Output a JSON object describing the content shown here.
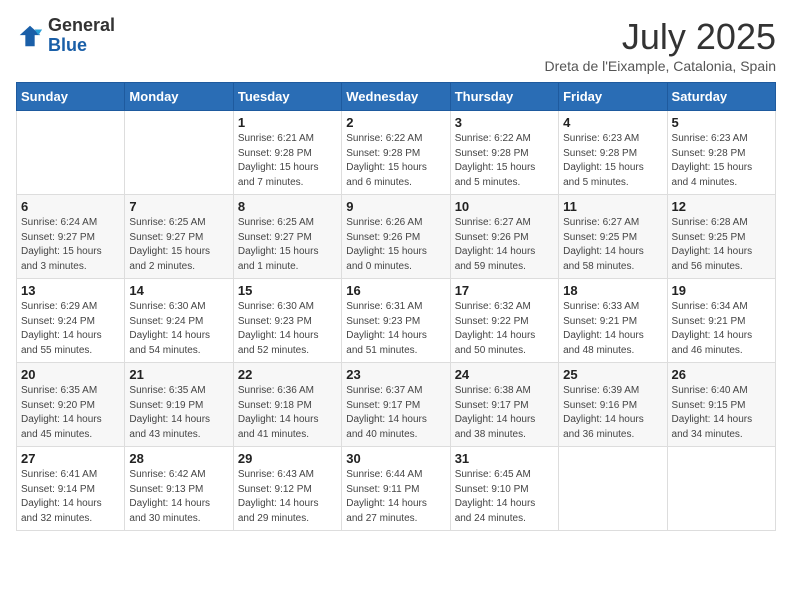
{
  "logo": {
    "general": "General",
    "blue": "Blue"
  },
  "title": {
    "month_year": "July 2025",
    "location": "Dreta de l'Eixample, Catalonia, Spain"
  },
  "days_of_week": [
    "Sunday",
    "Monday",
    "Tuesday",
    "Wednesday",
    "Thursday",
    "Friday",
    "Saturday"
  ],
  "weeks": [
    [
      {
        "day": "",
        "info": ""
      },
      {
        "day": "",
        "info": ""
      },
      {
        "day": "1",
        "info": "Sunrise: 6:21 AM\nSunset: 9:28 PM\nDaylight: 15 hours and 7 minutes."
      },
      {
        "day": "2",
        "info": "Sunrise: 6:22 AM\nSunset: 9:28 PM\nDaylight: 15 hours and 6 minutes."
      },
      {
        "day": "3",
        "info": "Sunrise: 6:22 AM\nSunset: 9:28 PM\nDaylight: 15 hours and 5 minutes."
      },
      {
        "day": "4",
        "info": "Sunrise: 6:23 AM\nSunset: 9:28 PM\nDaylight: 15 hours and 5 minutes."
      },
      {
        "day": "5",
        "info": "Sunrise: 6:23 AM\nSunset: 9:28 PM\nDaylight: 15 hours and 4 minutes."
      }
    ],
    [
      {
        "day": "6",
        "info": "Sunrise: 6:24 AM\nSunset: 9:27 PM\nDaylight: 15 hours and 3 minutes."
      },
      {
        "day": "7",
        "info": "Sunrise: 6:25 AM\nSunset: 9:27 PM\nDaylight: 15 hours and 2 minutes."
      },
      {
        "day": "8",
        "info": "Sunrise: 6:25 AM\nSunset: 9:27 PM\nDaylight: 15 hours and 1 minute."
      },
      {
        "day": "9",
        "info": "Sunrise: 6:26 AM\nSunset: 9:26 PM\nDaylight: 15 hours and 0 minutes."
      },
      {
        "day": "10",
        "info": "Sunrise: 6:27 AM\nSunset: 9:26 PM\nDaylight: 14 hours and 59 minutes."
      },
      {
        "day": "11",
        "info": "Sunrise: 6:27 AM\nSunset: 9:25 PM\nDaylight: 14 hours and 58 minutes."
      },
      {
        "day": "12",
        "info": "Sunrise: 6:28 AM\nSunset: 9:25 PM\nDaylight: 14 hours and 56 minutes."
      }
    ],
    [
      {
        "day": "13",
        "info": "Sunrise: 6:29 AM\nSunset: 9:24 PM\nDaylight: 14 hours and 55 minutes."
      },
      {
        "day": "14",
        "info": "Sunrise: 6:30 AM\nSunset: 9:24 PM\nDaylight: 14 hours and 54 minutes."
      },
      {
        "day": "15",
        "info": "Sunrise: 6:30 AM\nSunset: 9:23 PM\nDaylight: 14 hours and 52 minutes."
      },
      {
        "day": "16",
        "info": "Sunrise: 6:31 AM\nSunset: 9:23 PM\nDaylight: 14 hours and 51 minutes."
      },
      {
        "day": "17",
        "info": "Sunrise: 6:32 AM\nSunset: 9:22 PM\nDaylight: 14 hours and 50 minutes."
      },
      {
        "day": "18",
        "info": "Sunrise: 6:33 AM\nSunset: 9:21 PM\nDaylight: 14 hours and 48 minutes."
      },
      {
        "day": "19",
        "info": "Sunrise: 6:34 AM\nSunset: 9:21 PM\nDaylight: 14 hours and 46 minutes."
      }
    ],
    [
      {
        "day": "20",
        "info": "Sunrise: 6:35 AM\nSunset: 9:20 PM\nDaylight: 14 hours and 45 minutes."
      },
      {
        "day": "21",
        "info": "Sunrise: 6:35 AM\nSunset: 9:19 PM\nDaylight: 14 hours and 43 minutes."
      },
      {
        "day": "22",
        "info": "Sunrise: 6:36 AM\nSunset: 9:18 PM\nDaylight: 14 hours and 41 minutes."
      },
      {
        "day": "23",
        "info": "Sunrise: 6:37 AM\nSunset: 9:17 PM\nDaylight: 14 hours and 40 minutes."
      },
      {
        "day": "24",
        "info": "Sunrise: 6:38 AM\nSunset: 9:17 PM\nDaylight: 14 hours and 38 minutes."
      },
      {
        "day": "25",
        "info": "Sunrise: 6:39 AM\nSunset: 9:16 PM\nDaylight: 14 hours and 36 minutes."
      },
      {
        "day": "26",
        "info": "Sunrise: 6:40 AM\nSunset: 9:15 PM\nDaylight: 14 hours and 34 minutes."
      }
    ],
    [
      {
        "day": "27",
        "info": "Sunrise: 6:41 AM\nSunset: 9:14 PM\nDaylight: 14 hours and 32 minutes."
      },
      {
        "day": "28",
        "info": "Sunrise: 6:42 AM\nSunset: 9:13 PM\nDaylight: 14 hours and 30 minutes."
      },
      {
        "day": "29",
        "info": "Sunrise: 6:43 AM\nSunset: 9:12 PM\nDaylight: 14 hours and 29 minutes."
      },
      {
        "day": "30",
        "info": "Sunrise: 6:44 AM\nSunset: 9:11 PM\nDaylight: 14 hours and 27 minutes."
      },
      {
        "day": "31",
        "info": "Sunrise: 6:45 AM\nSunset: 9:10 PM\nDaylight: 14 hours and 24 minutes."
      },
      {
        "day": "",
        "info": ""
      },
      {
        "day": "",
        "info": ""
      }
    ]
  ]
}
